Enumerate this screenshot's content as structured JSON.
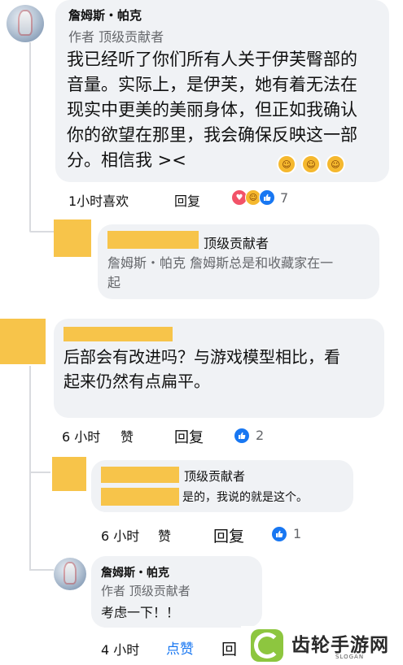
{
  "comment1": {
    "author": "詹姆斯・帕克",
    "badges": "作者 顶级贡献者",
    "text_lines": [
      "我已经听了你们所有人关于伊芙臀部的",
      "音量。实际上，是伊芙，她有着无法在",
      "现实中更美的美丽身体，但正如我确认",
      "你的欲望在那里，我会确保反映这一部",
      "分。相信我 ><"
    ],
    "time_likes": "1小时喜欢",
    "reply": "回复",
    "reaction_count": "7",
    "colors": {
      "like": "#1877f2",
      "love": "#f25268",
      "haha": "#f5b82e"
    },
    "icons": [
      "laughing-emoji-icon",
      "laughing-emoji-icon",
      "laughing-emoji-icon"
    ]
  },
  "reply1": {
    "badge": "顶级贡献者",
    "text_line1": "詹姆斯总是和收藏家在一",
    "text_line2": "起",
    "prefix": "詹姆斯・帕克 "
  },
  "comment2": {
    "text_lines": [
      "后部会有改进吗？与游戏模型相比，看",
      "起来仍然有点扁平。"
    ],
    "time": "6 小时",
    "like": "赞",
    "reply": "回复",
    "reaction_count": "2"
  },
  "reply2": {
    "badge": "顶级贡献者",
    "text": "是的，我说的就是这个。",
    "time": "6 小时",
    "like": "赞",
    "reply": "回复",
    "reaction_count": "1"
  },
  "reply3": {
    "author": "詹姆斯・帕克",
    "badges": "作者 顶级贡献者",
    "text": "考虑一下！！",
    "time": "4 小时",
    "like": "点赞",
    "reply": "回"
  },
  "watermark": {
    "text": "齿轮手游网",
    "slogan": "SLOGAN",
    "color": "#8dc63f"
  }
}
